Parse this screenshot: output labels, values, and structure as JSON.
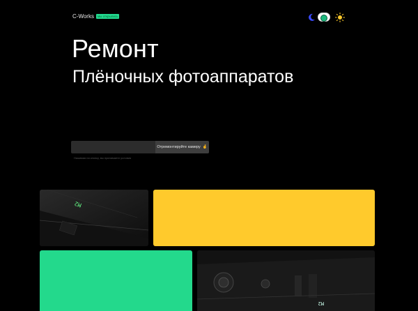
{
  "header": {
    "brand": "C-Works",
    "status_badge": "мы открылись"
  },
  "hero": {
    "title": "Ремонт",
    "subtitle": "Плёночных фотоаппаратов"
  },
  "request_form": {
    "input_value": "",
    "button_label": "Отремонтируйте камеру",
    "button_emoji": "🤞"
  },
  "hint_text": "Нажимая на кнопку, вы принимаете условия",
  "photo_labels": {
    "top": "M2",
    "bottom": "M2"
  },
  "colors": {
    "background": "#000000",
    "accent_green": "#23d98c",
    "accent_yellow": "#ffca2c"
  },
  "icons": [
    "moon-icon",
    "theme-toggle",
    "sun-icon"
  ]
}
